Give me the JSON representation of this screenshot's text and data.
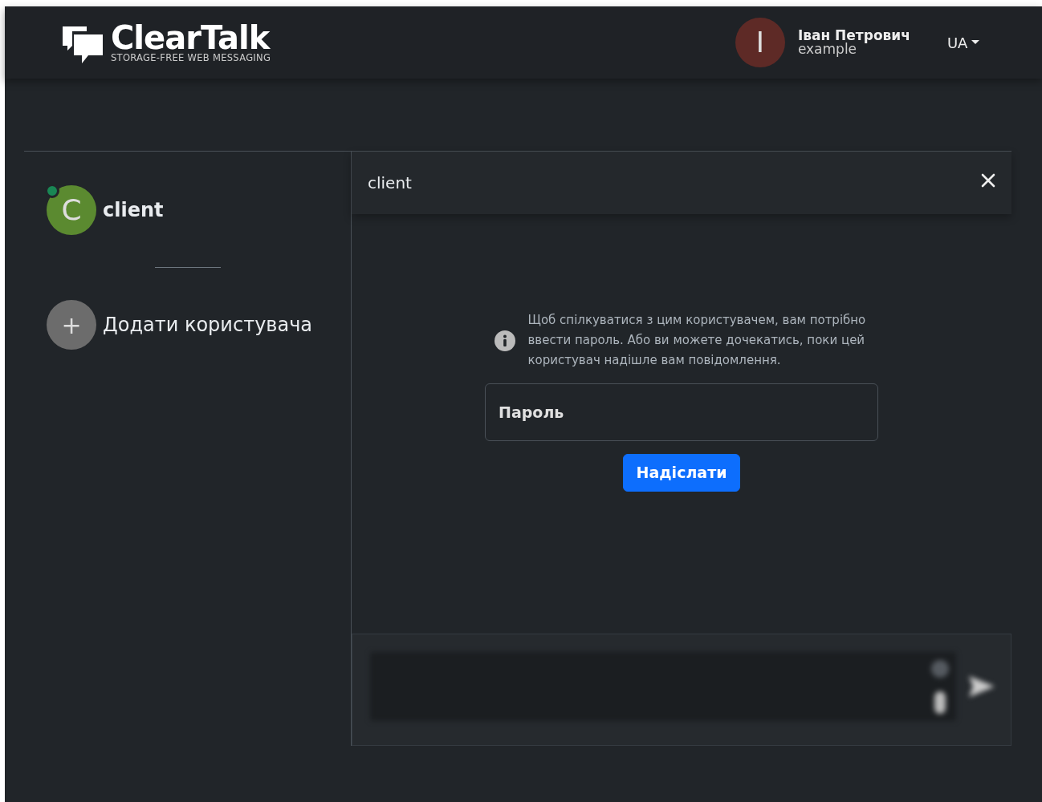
{
  "header": {
    "logo_title": "ClearTalk",
    "logo_subtitle": "STORAGE-FREE WEB MESSAGING",
    "user": {
      "initial": "I",
      "name": "Іван Петрович",
      "login": "example"
    },
    "language": "UA"
  },
  "contacts": [
    {
      "initial": "C",
      "name": "client",
      "online": true,
      "color": "#5b8a30"
    }
  ],
  "add_contact": {
    "icon": "+",
    "label": "Додати користувача"
  },
  "chat": {
    "title": "client",
    "notice": "Щоб спілкуватися з цим користувачем, вам потрібно ввести пароль. Або ви можете дочекатись, поки цей користувач надішле вам повідомлення.",
    "password": {
      "placeholder": "Пароль"
    },
    "submit": "Надіслати",
    "composer": {
      "disabled": true
    }
  }
}
